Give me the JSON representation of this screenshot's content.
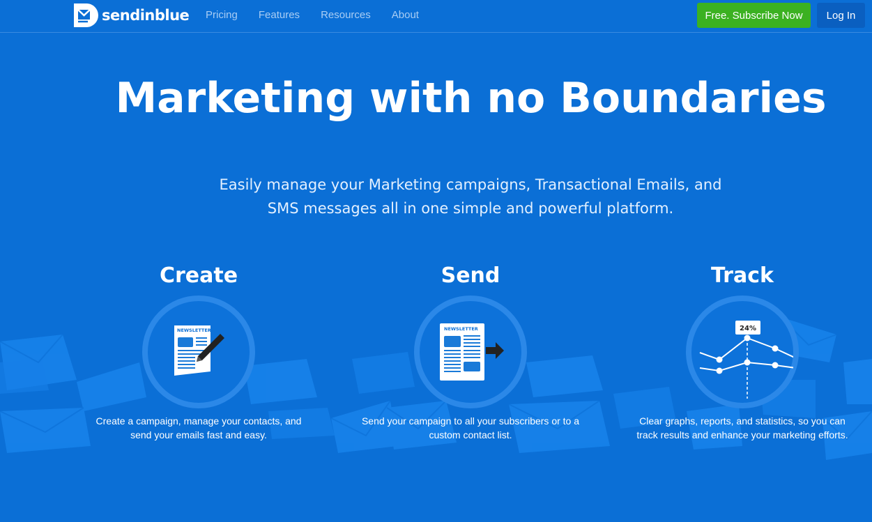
{
  "brand": {
    "name": "sendinblue"
  },
  "nav": {
    "links": [
      "Pricing",
      "Features",
      "Resources",
      "About"
    ],
    "subscribe_label": "Free. Subscribe Now",
    "login_label": "Log In"
  },
  "hero": {
    "title": "Marketing with no Boundaries",
    "subtitle_line1": "Easily manage your Marketing campaigns, Transactional Emails, and",
    "subtitle_line2": "SMS messages all in one simple and powerful platform."
  },
  "features": [
    {
      "title": "Create",
      "desc_line1": "Create a campaign, manage your contacts, and",
      "desc_line2": "send your emails fast and easy.",
      "icon": "newsletter-edit-icon",
      "badge": "NEWSLETTER"
    },
    {
      "title": "Send",
      "desc_line1": "Send your campaign to all your subscribers or to a",
      "desc_line2": "custom contact list.",
      "icon": "newsletter-send-icon",
      "badge": "NEWSLETTER"
    },
    {
      "title": "Track",
      "desc_line1": "Clear graphs, reports, and statistics, so you can",
      "desc_line2": "track results and enhance your marketing efforts.",
      "icon": "line-graph-icon",
      "stat": "24%"
    }
  ],
  "colors": {
    "background": "#0b6fd6",
    "subscribe_button": "#3bb121",
    "login_button": "#0a5fc0",
    "nav_link": "#a9cdf4",
    "envelope": "#1a86ee"
  }
}
